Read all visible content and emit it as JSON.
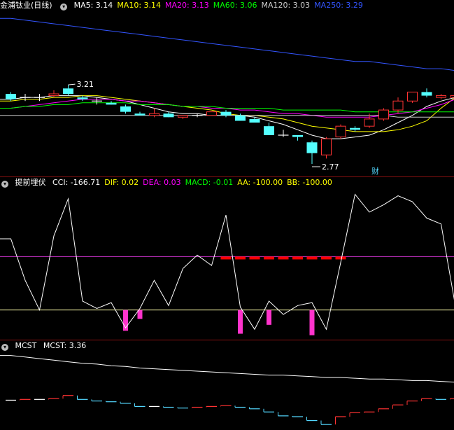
{
  "main": {
    "title": "金浦钛业(日线)",
    "ma": [
      {
        "label": "MA5:",
        "value": "3.14",
        "color": "#ffffff"
      },
      {
        "label": "MA10:",
        "value": "3.14",
        "color": "#ffff00"
      },
      {
        "label": "MA20:",
        "value": "3.13",
        "color": "#ff00ff"
      },
      {
        "label": "MA60:",
        "value": "3.06",
        "color": "#00ff00"
      },
      {
        "label": "MA120:",
        "value": "3.03",
        "color": "#cccccc"
      },
      {
        "label": "MA250:",
        "value": "3.29",
        "color": "#3355ff"
      }
    ],
    "high_label": "3.21",
    "low_label": "2.77",
    "event_label": "财"
  },
  "ind1": {
    "name": "提前埋伏",
    "items": [
      {
        "label": "CCI:",
        "value": "-166.71",
        "color": "#ffffff"
      },
      {
        "label": "DIF:",
        "value": "0.02",
        "color": "#ffff00"
      },
      {
        "label": "DEA:",
        "value": "0.03",
        "color": "#ff00ff"
      },
      {
        "label": "MACD:",
        "value": "-0.01",
        "color": "#00ff00"
      },
      {
        "label": "AA:",
        "value": "-100.00",
        "color": "#ffff00"
      },
      {
        "label": "BB:",
        "value": "-100.00",
        "color": "#ffff00"
      }
    ]
  },
  "ind2": {
    "name": "MCST",
    "items": [
      {
        "label": "MCST:",
        "value": "3.36",
        "color": "#ffffff"
      }
    ]
  },
  "chart_data": [
    {
      "type": "candlestick",
      "title": "金浦钛业(日线)",
      "x": [
        1,
        2,
        3,
        4,
        5,
        6,
        7,
        8,
        9,
        10,
        11,
        12,
        13,
        14,
        15,
        16,
        17,
        18,
        19,
        20,
        21,
        22,
        23,
        24,
        25,
        26,
        27,
        28,
        29,
        30,
        31,
        32
      ],
      "candles": [
        {
          "o": 3.16,
          "h": 3.17,
          "l": 3.12,
          "c": 3.13
        },
        {
          "o": 3.14,
          "h": 3.16,
          "l": 3.12,
          "c": 3.14
        },
        {
          "o": 3.14,
          "h": 3.16,
          "l": 3.12,
          "c": 3.14
        },
        {
          "o": 3.15,
          "h": 3.18,
          "l": 3.14,
          "c": 3.16
        },
        {
          "o": 3.19,
          "h": 3.21,
          "l": 3.15,
          "c": 3.16
        },
        {
          "o": 3.14,
          "h": 3.15,
          "l": 3.12,
          "c": 3.13
        },
        {
          "o": 3.12,
          "h": 3.14,
          "l": 3.1,
          "c": 3.12
        },
        {
          "o": 3.11,
          "h": 3.12,
          "l": 3.1,
          "c": 3.1
        },
        {
          "o": 3.09,
          "h": 3.1,
          "l": 3.05,
          "c": 3.06
        },
        {
          "o": 3.05,
          "h": 3.06,
          "l": 3.04,
          "c": 3.04
        },
        {
          "o": 3.04,
          "h": 3.08,
          "l": 3.03,
          "c": 3.05
        },
        {
          "o": 3.05,
          "h": 3.06,
          "l": 3.03,
          "c": 3.03
        },
        {
          "o": 3.03,
          "h": 3.04,
          "l": 3.02,
          "c": 3.04
        },
        {
          "o": 3.04,
          "h": 3.05,
          "l": 3.03,
          "c": 3.04
        },
        {
          "o": 3.04,
          "h": 3.06,
          "l": 3.04,
          "c": 3.06
        },
        {
          "o": 3.06,
          "h": 3.07,
          "l": 3.03,
          "c": 3.04
        },
        {
          "o": 3.04,
          "h": 3.05,
          "l": 3.01,
          "c": 3.01
        },
        {
          "o": 3.02,
          "h": 3.03,
          "l": 3.0,
          "c": 3.0
        },
        {
          "o": 2.98,
          "h": 3.0,
          "l": 2.93,
          "c": 2.93
        },
        {
          "o": 2.93,
          "h": 2.96,
          "l": 2.92,
          "c": 2.93
        },
        {
          "o": 2.93,
          "h": 2.93,
          "l": 2.9,
          "c": 2.92
        },
        {
          "o": 2.89,
          "h": 2.9,
          "l": 2.77,
          "c": 2.83
        },
        {
          "o": 2.82,
          "h": 2.92,
          "l": 2.8,
          "c": 2.91
        },
        {
          "o": 2.92,
          "h": 2.99,
          "l": 2.91,
          "c": 2.98
        },
        {
          "o": 2.97,
          "h": 2.98,
          "l": 2.95,
          "c": 2.96
        },
        {
          "o": 2.98,
          "h": 3.05,
          "l": 2.97,
          "c": 3.02
        },
        {
          "o": 3.02,
          "h": 3.08,
          "l": 3.01,
          "c": 3.07
        },
        {
          "o": 3.07,
          "h": 3.14,
          "l": 3.05,
          "c": 3.12
        },
        {
          "o": 3.12,
          "h": 3.17,
          "l": 3.11,
          "c": 3.17
        },
        {
          "o": 3.17,
          "h": 3.19,
          "l": 3.14,
          "c": 3.15
        },
        {
          "o": 3.14,
          "h": 3.16,
          "l": 3.13,
          "c": 3.15
        },
        {
          "o": 3.14,
          "h": 3.22,
          "l": 3.13,
          "c": 3.15
        }
      ],
      "series": [
        {
          "name": "MA5",
          "color": "#ffffff",
          "values": [
            3.13,
            3.14,
            3.14,
            3.15,
            3.15,
            3.15,
            3.14,
            3.13,
            3.12,
            3.1,
            3.08,
            3.06,
            3.05,
            3.05,
            3.04,
            3.04,
            3.04,
            3.03,
            3.01,
            2.99,
            2.96,
            2.93,
            2.91,
            2.91,
            2.92,
            2.93,
            2.96,
            3.0,
            3.04,
            3.09,
            3.12,
            3.14
          ]
        },
        {
          "name": "MA10",
          "color": "#ffff00",
          "values": [
            3.12,
            3.13,
            3.13,
            3.14,
            3.14,
            3.15,
            3.15,
            3.14,
            3.13,
            3.12,
            3.11,
            3.1,
            3.09,
            3.08,
            3.07,
            3.05,
            3.04,
            3.04,
            3.03,
            3.02,
            3.0,
            2.98,
            2.97,
            2.96,
            2.95,
            2.95,
            2.95,
            2.96,
            2.98,
            3.01,
            3.08,
            3.14
          ]
        },
        {
          "name": "MA20",
          "color": "#ff00ff",
          "values": [
            3.08,
            3.09,
            3.1,
            3.11,
            3.12,
            3.13,
            3.13,
            3.13,
            3.12,
            3.12,
            3.11,
            3.1,
            3.09,
            3.09,
            3.08,
            3.08,
            3.07,
            3.07,
            3.06,
            3.05,
            3.05,
            3.04,
            3.03,
            3.03,
            3.03,
            3.03,
            3.04,
            3.05,
            3.06,
            3.08,
            3.1,
            3.13
          ]
        },
        {
          "name": "MA60",
          "color": "#00ff00",
          "values": [
            3.08,
            3.09,
            3.09,
            3.1,
            3.1,
            3.11,
            3.11,
            3.11,
            3.11,
            3.1,
            3.1,
            3.1,
            3.09,
            3.09,
            3.09,
            3.08,
            3.08,
            3.08,
            3.08,
            3.07,
            3.07,
            3.07,
            3.07,
            3.07,
            3.06,
            3.06,
            3.06,
            3.06,
            3.06,
            3.06,
            3.06,
            3.06
          ]
        },
        {
          "name": "MA120",
          "color": "#cccccc",
          "values": [
            3.04,
            3.04,
            3.04,
            3.04,
            3.04,
            3.04,
            3.04,
            3.04,
            3.04,
            3.04,
            3.04,
            3.04,
            3.04,
            3.04,
            3.04,
            3.04,
            3.04,
            3.04,
            3.04,
            3.04,
            3.04,
            3.04,
            3.04,
            3.04,
            3.04,
            3.04,
            3.04,
            3.03,
            3.03,
            3.03,
            3.03,
            3.03
          ]
        },
        {
          "name": "MA250",
          "color": "#3355ff",
          "values": [
            3.58,
            3.57,
            3.56,
            3.55,
            3.54,
            3.53,
            3.52,
            3.51,
            3.5,
            3.49,
            3.48,
            3.47,
            3.46,
            3.45,
            3.44,
            3.43,
            3.42,
            3.41,
            3.4,
            3.39,
            3.38,
            3.37,
            3.36,
            3.35,
            3.34,
            3.34,
            3.33,
            3.32,
            3.31,
            3.3,
            3.3,
            3.29
          ]
        }
      ],
      "ylim": [
        2.7,
        3.62
      ],
      "annotations": [
        {
          "x": 5,
          "y": 3.21,
          "text": "3.21"
        },
        {
          "x": 22,
          "y": 2.77,
          "text": "2.77"
        },
        {
          "x": 26,
          "text": "财"
        }
      ]
    },
    {
      "type": "line",
      "title": "提前埋伏",
      "x": [
        1,
        2,
        3,
        4,
        5,
        6,
        7,
        8,
        9,
        10,
        11,
        12,
        13,
        14,
        15,
        16,
        17,
        18,
        19,
        20,
        21,
        22,
        23,
        24,
        25,
        26,
        27,
        28,
        29,
        30,
        31,
        32
      ],
      "series": [
        {
          "name": "CCI",
          "color": "#ffffff",
          "values": [
            60,
            -80,
            -180,
            70,
            195,
            -150,
            -175,
            -155,
            -240,
            -175,
            -80,
            -165,
            -40,
            5,
            -30,
            140,
            -170,
            -245,
            -150,
            -195,
            -165,
            -155,
            -245,
            -20,
            210,
            150,
            175,
            205,
            185,
            130,
            110,
            -167
          ]
        }
      ],
      "bars": [
        {
          "name": "AA",
          "color": "#ff33cc",
          "x": [
            9,
            10,
            17,
            19,
            22
          ],
          "values": [
            -250,
            -210,
            -260,
            -230,
            -265
          ]
        },
        {
          "name": "BB",
          "color": "#ff0000",
          "x": [
            16,
            17,
            18,
            19,
            20,
            21,
            22,
            23,
            24
          ],
          "values": [
            0,
            0,
            0,
            0,
            0,
            0,
            0,
            0,
            0
          ]
        }
      ],
      "reference_lines": [
        {
          "y": 0,
          "color": "#cc33cc"
        },
        {
          "y": -180,
          "color": "#ffffaa"
        }
      ],
      "ylim": [
        -280,
        230
      ]
    },
    {
      "type": "line",
      "title": "MCST",
      "x": [
        1,
        2,
        3,
        4,
        5,
        6,
        7,
        8,
        9,
        10,
        11,
        12,
        13,
        14,
        15,
        16,
        17,
        18,
        19,
        20,
        21,
        22,
        23,
        24,
        25,
        26,
        27,
        28,
        29,
        30,
        31,
        32
      ],
      "series": [
        {
          "name": "MCST",
          "color": "#ffffff",
          "values": [
            3.7,
            3.68,
            3.66,
            3.64,
            3.62,
            3.6,
            3.59,
            3.57,
            3.56,
            3.54,
            3.53,
            3.52,
            3.51,
            3.5,
            3.49,
            3.48,
            3.47,
            3.46,
            3.45,
            3.45,
            3.44,
            3.43,
            3.42,
            3.42,
            3.41,
            3.4,
            3.4,
            3.39,
            3.38,
            3.38,
            3.37,
            3.36
          ]
        }
      ],
      "steps": {
        "values": [
          3.13,
          3.14,
          3.14,
          3.15,
          3.19,
          3.14,
          3.12,
          3.11,
          3.09,
          3.05,
          3.05,
          3.04,
          3.03,
          3.04,
          3.05,
          3.06,
          3.04,
          3.02,
          2.98,
          2.93,
          2.92,
          2.87,
          2.82,
          2.92,
          2.97,
          2.98,
          3.02,
          3.07,
          3.12,
          3.15,
          3.14,
          3.15
        ],
        "up_color": "#ff3333",
        "down_color": "#54d8ff",
        "flat_color": "#ffffff"
      },
      "ylim": [
        2.75,
        3.75
      ]
    }
  ]
}
